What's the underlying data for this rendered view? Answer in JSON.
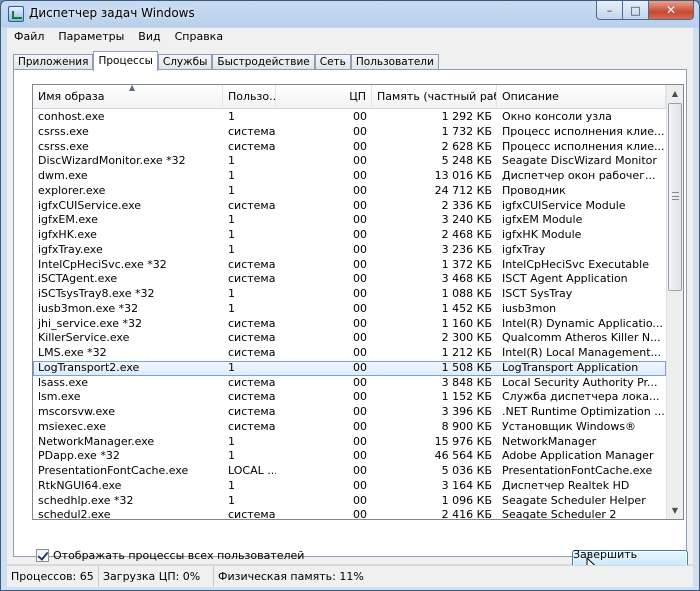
{
  "window": {
    "title": "Диспетчер задач Windows",
    "close_label": "✕",
    "min_label": "–",
    "max_label": "□"
  },
  "menu": [
    "Файл",
    "Параметры",
    "Вид",
    "Справка"
  ],
  "tabs": [
    "Приложения",
    "Процессы",
    "Службы",
    "Быстродействие",
    "Сеть",
    "Пользователи"
  ],
  "active_tab": "Процессы",
  "columns": {
    "name": "Имя образа",
    "user": "Пользо...",
    "cpu": "ЦП",
    "memory": "Память (частный рабоч...",
    "description": "Описание"
  },
  "processes": [
    {
      "name": "conhost.exe",
      "user": "1",
      "cpu": "00",
      "memory": "1 292 КБ",
      "description": "Окно консоли узла"
    },
    {
      "name": "csrss.exe",
      "user": "система",
      "cpu": "00",
      "memory": "1 732 КБ",
      "description": "Процесс исполнения клие..."
    },
    {
      "name": "csrss.exe",
      "user": "система",
      "cpu": "00",
      "memory": "2 628 КБ",
      "description": "Процесс исполнения клие..."
    },
    {
      "name": "DiscWizardMonitor.exe *32",
      "user": "1",
      "cpu": "00",
      "memory": "5 248 КБ",
      "description": "Seagate DiscWizard Monitor"
    },
    {
      "name": "dwm.exe",
      "user": "1",
      "cpu": "00",
      "memory": "13 016 КБ",
      "description": "Диспетчер окон рабочег..."
    },
    {
      "name": "explorer.exe",
      "user": "1",
      "cpu": "00",
      "memory": "24 712 КБ",
      "description": "Проводник"
    },
    {
      "name": "igfxCUIService.exe",
      "user": "система",
      "cpu": "00",
      "memory": "2 336 КБ",
      "description": "igfxCUIService Module"
    },
    {
      "name": "igfxEM.exe",
      "user": "1",
      "cpu": "00",
      "memory": "3 240 КБ",
      "description": "igfxEM Module"
    },
    {
      "name": "igfxHK.exe",
      "user": "1",
      "cpu": "00",
      "memory": "2 468 КБ",
      "description": "igfxHK Module"
    },
    {
      "name": "igfxTray.exe",
      "user": "1",
      "cpu": "00",
      "memory": "3 236 КБ",
      "description": "igfxTray"
    },
    {
      "name": "IntelCpHeciSvc.exe *32",
      "user": "система",
      "cpu": "00",
      "memory": "1 372 КБ",
      "description": "IntelCpHeciSvc Executable"
    },
    {
      "name": "iSCTAgent.exe",
      "user": "система",
      "cpu": "00",
      "memory": "3 468 КБ",
      "description": "ISCT Agent Application"
    },
    {
      "name": "iSCTsysTray8.exe *32",
      "user": "1",
      "cpu": "00",
      "memory": "1 088 КБ",
      "description": "ISCT SysTray"
    },
    {
      "name": "iusb3mon.exe *32",
      "user": "1",
      "cpu": "00",
      "memory": "1 452 КБ",
      "description": "iusb3mon"
    },
    {
      "name": "jhi_service.exe *32",
      "user": "система",
      "cpu": "00",
      "memory": "1 160 КБ",
      "description": "Intel(R) Dynamic Applicatio..."
    },
    {
      "name": "KillerService.exe",
      "user": "система",
      "cpu": "00",
      "memory": "2 300 КБ",
      "description": "Qualcomm Atheros Killer N..."
    },
    {
      "name": "LMS.exe *32",
      "user": "система",
      "cpu": "00",
      "memory": "1 212 КБ",
      "description": "Intel(R) Local Management..."
    },
    {
      "name": "LogTransport2.exe",
      "user": "1",
      "cpu": "00",
      "memory": "1 508 КБ",
      "description": "LogTransport Application",
      "selected": true
    },
    {
      "name": "lsass.exe",
      "user": "система",
      "cpu": "00",
      "memory": "3 848 КБ",
      "description": "Local Security Authority Pr..."
    },
    {
      "name": "lsm.exe",
      "user": "система",
      "cpu": "00",
      "memory": "1 152 КБ",
      "description": "Служба диспетчера лока..."
    },
    {
      "name": "mscorsvw.exe",
      "user": "система",
      "cpu": "00",
      "memory": "3 396 КБ",
      "description": ".NET Runtime Optimization ..."
    },
    {
      "name": "msiexec.exe",
      "user": "система",
      "cpu": "00",
      "memory": "8 900 КБ",
      "description": "Установщик Windows®"
    },
    {
      "name": "NetworkManager.exe",
      "user": "1",
      "cpu": "00",
      "memory": "15 976 КБ",
      "description": "NetworkManager"
    },
    {
      "name": "PDapp.exe *32",
      "user": "1",
      "cpu": "00",
      "memory": "46 564 КБ",
      "description": "Adobe Application Manager"
    },
    {
      "name": "PresentationFontCache.exe",
      "user": "LOCAL ...",
      "cpu": "00",
      "memory": "5 036 КБ",
      "description": "PresentationFontCache.exe"
    },
    {
      "name": "RtkNGUI64.exe",
      "user": "1",
      "cpu": "00",
      "memory": "3 164 КБ",
      "description": "Диспетчер Realtek HD"
    },
    {
      "name": "schedhlp.exe *32",
      "user": "1",
      "cpu": "00",
      "memory": "1 096 КБ",
      "description": "Seagate Scheduler Helper"
    },
    {
      "name": "schedul2.exe",
      "user": "система",
      "cpu": "00",
      "memory": "2 416 КБ",
      "description": "Seagate Scheduler 2"
    }
  ],
  "show_all_users": {
    "label": "Отображать процессы всех пользователей",
    "checked": true
  },
  "end_process_label": "Завершить процесс",
  "status": {
    "processes": "Процессов: 65",
    "cpu": "Загрузка ЦП: 0%",
    "memory": "Физическая память: 11%"
  }
}
